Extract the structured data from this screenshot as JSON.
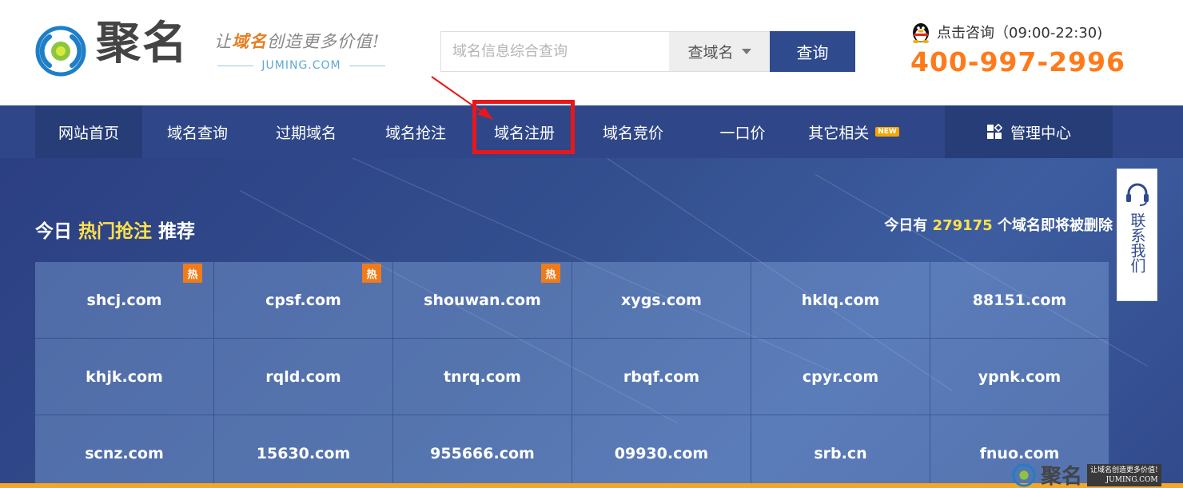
{
  "header": {
    "brand": "聚名",
    "slogan_pre": "让",
    "slogan_hl": "域名",
    "slogan_post": "创造更多价值!",
    "slogan_sub": "JUMING.COM",
    "search_placeholder": "域名信息综合查询",
    "search_type": "查域名",
    "search_button": "查询",
    "consult": "点击咨询（09:00-22:30)",
    "phone": "400-997-2996"
  },
  "nav": {
    "items": [
      {
        "label": "网站首页"
      },
      {
        "label": "域名查询"
      },
      {
        "label": "过期域名"
      },
      {
        "label": "域名抢注"
      },
      {
        "label": "域名注册"
      },
      {
        "label": "域名竞价"
      },
      {
        "label": "一口价"
      },
      {
        "label": "其它相关"
      }
    ],
    "new_badge": "NEW",
    "manage": "管理中心"
  },
  "hero": {
    "title_pre": "今日 ",
    "title_hl": "热门抢注",
    "title_post": " 推荐",
    "count_pre": "今日有 ",
    "count_num": "279175",
    "count_post": " 个域名即将被删除",
    "hot_label": "热",
    "domains": [
      {
        "name": "shcj.com",
        "hot": true
      },
      {
        "name": "cpsf.com",
        "hot": true
      },
      {
        "name": "shouwan.com",
        "hot": true
      },
      {
        "name": "xygs.com",
        "hot": false
      },
      {
        "name": "hklq.com",
        "hot": false
      },
      {
        "name": "88151.com",
        "hot": false
      },
      {
        "name": "khjk.com",
        "hot": false
      },
      {
        "name": "rqld.com",
        "hot": false
      },
      {
        "name": "tnrq.com",
        "hot": false
      },
      {
        "name": "rbqf.com",
        "hot": false
      },
      {
        "name": "cpyr.com",
        "hot": false
      },
      {
        "name": "ypnk.com",
        "hot": false
      },
      {
        "name": "scnz.com",
        "hot": false
      },
      {
        "name": "15630.com",
        "hot": false
      },
      {
        "name": "955666.com",
        "hot": false
      },
      {
        "name": "09930.com",
        "hot": false
      },
      {
        "name": "srb.cn",
        "hot": false
      },
      {
        "name": "fnuo.com",
        "hot": false
      }
    ]
  },
  "contact": {
    "label": "联系我们"
  },
  "watermark": {
    "brand": "聚名",
    "slogan": "让域名创造更多价值!",
    "sub": "JUMING.COM"
  },
  "colors": {
    "nav": "#2f4788",
    "accent": "#ff7a1a",
    "highlight": "#ffe14d",
    "annotation": "#e8171b"
  }
}
